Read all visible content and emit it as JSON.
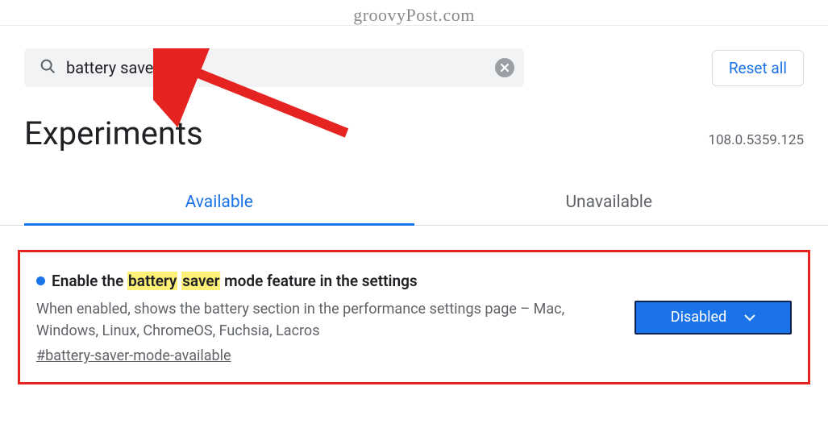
{
  "watermark": "groovyPost.com",
  "search": {
    "value": "battery saver"
  },
  "reset_label": "Reset all",
  "page_title": "Experiments",
  "version": "108.0.5359.125",
  "tabs": {
    "available": "Available",
    "unavailable": "Unavailable"
  },
  "flag": {
    "title_pre": "Enable the ",
    "title_hl1": "battery",
    "title_mid": " ",
    "title_hl2": "saver",
    "title_post": " mode feature in the settings",
    "description": "When enabled, shows the battery section in the performance settings page – Mac, Windows, Linux, ChromeOS, Fuchsia, Lacros",
    "id": "#battery-saver-mode-available",
    "dropdown_value": "Disabled"
  }
}
